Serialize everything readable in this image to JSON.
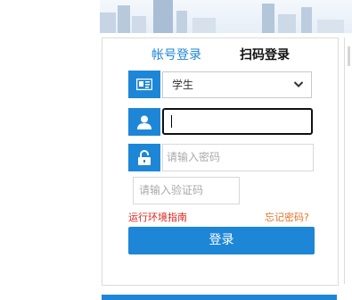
{
  "tabs": {
    "account_label": "帐号登录",
    "qr_label": "扫码登录"
  },
  "role_select": {
    "icon": "id-card-icon",
    "selected": "学生"
  },
  "username": {
    "icon": "user-icon",
    "value": ""
  },
  "password": {
    "icon": "lock-icon",
    "placeholder": "请输入密码"
  },
  "captcha": {
    "placeholder": "请输入验证码"
  },
  "links": {
    "env_guide": "运行环境指南",
    "forgot_password": "忘记密码?"
  },
  "login_button_label": "登录",
  "colors": {
    "accent": "#1e86d6",
    "env_link": "#d9261c",
    "forgot_link": "#e0742a"
  }
}
